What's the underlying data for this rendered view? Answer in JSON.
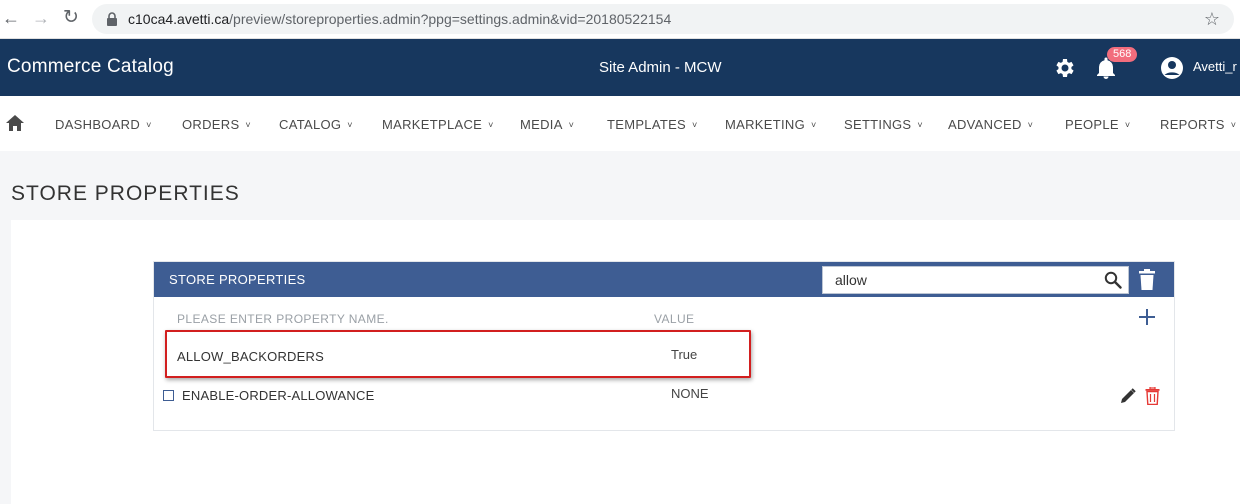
{
  "browser": {
    "url_host": "c10ca4.avetti.ca",
    "url_path": "/preview/storeproperties.admin?ppg=settings.admin&vid=20180522154"
  },
  "header": {
    "app_title": "Commerce Catalog",
    "site_title": "Site Admin - MCW",
    "notification_count": "568",
    "user_name": "Avetti_r",
    "colors": {
      "header_bg": "#17375e",
      "badge": "#f26d7d"
    }
  },
  "nav": {
    "items": [
      {
        "label": "DASHBOARD",
        "chevron": "˅"
      },
      {
        "label": "ORDERS",
        "chevron": "˅"
      },
      {
        "label": "CATALOG",
        "chevron": "˅"
      },
      {
        "label": "MARKETPLACE",
        "chevron": "˅"
      },
      {
        "label": "MEDIA",
        "chevron": "˅"
      },
      {
        "label": "TEMPLATES",
        "chevron": "˅"
      },
      {
        "label": "MARKETING",
        "chevron": "˅"
      },
      {
        "label": "SETTINGS",
        "chevron": "˅"
      },
      {
        "label": "ADVANCED",
        "chevron": "˅"
      },
      {
        "label": "PEOPLE",
        "chevron": "˅"
      },
      {
        "label": "REPORTS",
        "chevron": "˅"
      }
    ]
  },
  "page": {
    "title": "STORE PROPERTIES"
  },
  "panel": {
    "title": "STORE PROPERTIES",
    "search_value": "allow",
    "col_name_placeholder": "PLEASE ENTER PROPERTY NAME.",
    "col_value_header": "VALUE",
    "colors": {
      "panel_head": "#3e5d93",
      "highlight": "#d21f1f",
      "delete": "#e53935"
    },
    "rows": [
      {
        "name": "ALLOW_BACKORDERS",
        "value": "True"
      },
      {
        "name": "ENABLE-ORDER-ALLOWANCE",
        "value": "NONE"
      }
    ]
  }
}
